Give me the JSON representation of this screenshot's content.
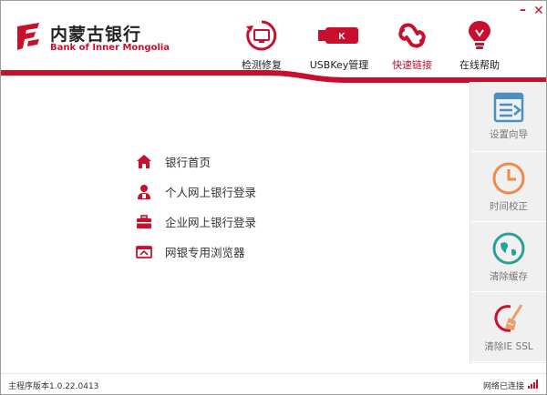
{
  "header": {
    "logo_cn": "内蒙古银行",
    "logo_en": "Bank of Inner Mongolia",
    "window_min": "–",
    "window_close": "✕"
  },
  "nav": [
    {
      "label": "检测修复",
      "icon": "monitor-repair-icon",
      "active": false
    },
    {
      "label": "USBKey管理",
      "icon": "usb-key-icon",
      "active": false
    },
    {
      "label": "快速链接",
      "icon": "link-icon",
      "active": true
    },
    {
      "label": "在线帮助",
      "icon": "lightbulb-icon",
      "active": false
    }
  ],
  "links": [
    {
      "label": "银行首页",
      "icon": "home-icon"
    },
    {
      "label": "个人网上银行登录",
      "icon": "person-icon"
    },
    {
      "label": "企业网上银行登录",
      "icon": "briefcase-icon"
    },
    {
      "label": "网银专用浏览器",
      "icon": "browser-icon"
    }
  ],
  "tools": [
    {
      "label": "设置向导",
      "icon": "settings-wizard-icon"
    },
    {
      "label": "时间校正",
      "icon": "clock-icon"
    },
    {
      "label": "清除缓存",
      "icon": "globe-icon"
    },
    {
      "label": "清除IE SSL",
      "icon": "broom-icon"
    }
  ],
  "status": {
    "version": "主程序版本1.0.22.0413",
    "network": "网络已连接"
  },
  "colors": {
    "accent": "#c8102e",
    "tool_blue": "#4a90c2",
    "tool_orange": "#ee8a4a",
    "tool_teal": "#2aa198"
  }
}
